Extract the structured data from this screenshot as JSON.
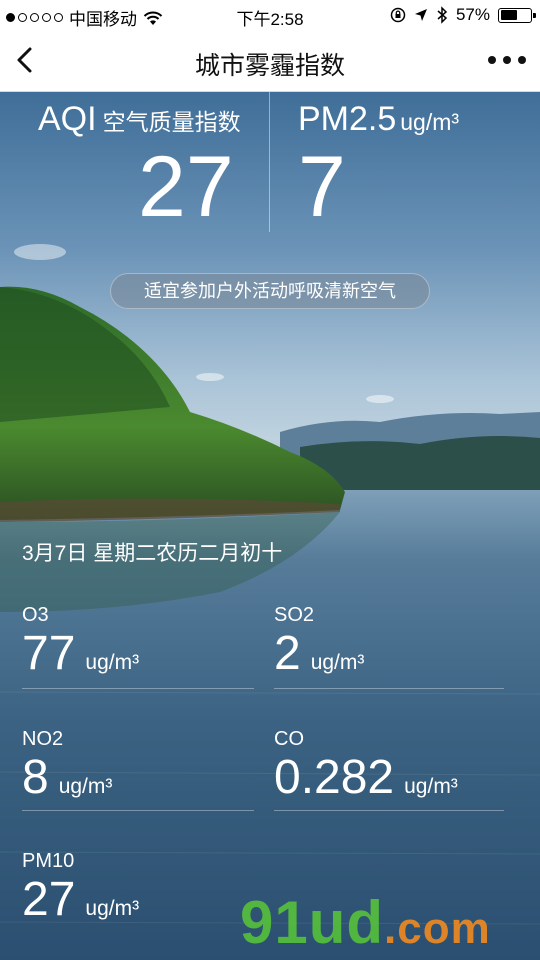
{
  "status_bar": {
    "carrier": "中国移动",
    "time": "下午2:58",
    "battery_percent": "57%",
    "battery_level": 0.57,
    "signal_bars": 1,
    "icons": [
      "wifi-icon",
      "rotation-lock-icon",
      "location-icon",
      "bluetooth-icon",
      "battery-icon"
    ]
  },
  "nav": {
    "title": "城市雾霾指数",
    "back_icon": "chevron-left-icon",
    "more_icon": "more-dots-icon"
  },
  "summary": {
    "aqi_label": "AQI",
    "aqi_label_zh": "空气质量指数",
    "aqi_value": "27",
    "pm_label": "PM2.5",
    "pm_unit": "ug/m³",
    "pm_value": "7"
  },
  "advice": "适宜参加户外活动呼吸清新空气",
  "date": "3月7日  星期二农历二月初十",
  "metrics": [
    {
      "name": "O3",
      "value": "77",
      "unit": "ug/m³"
    },
    {
      "name": "SO2",
      "value": "2",
      "unit": "ug/m³"
    },
    {
      "name": "NO2",
      "value": "8",
      "unit": "ug/m³"
    },
    {
      "name": "CO",
      "value": "0.282",
      "unit": "ug/m³"
    },
    {
      "name": "PM10",
      "value": "27",
      "unit": "ug/m³"
    }
  ],
  "watermark": {
    "main": "91ud",
    "suffix": ".com"
  },
  "colors": {
    "watermark_green": "#56c13b",
    "watermark_orange": "#f08a1f"
  }
}
